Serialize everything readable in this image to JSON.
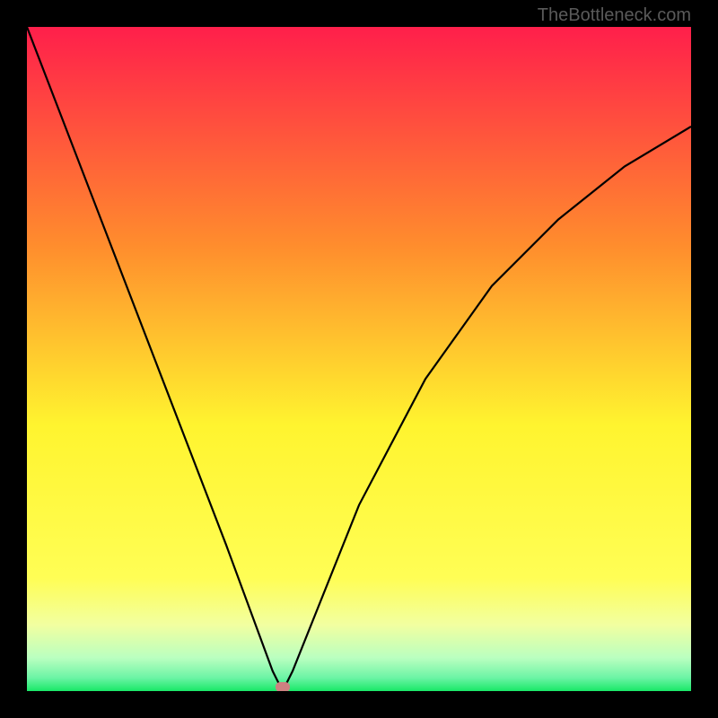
{
  "watermark": "TheBottleneck.com",
  "chart_data": {
    "type": "line",
    "title": "",
    "xlabel": "",
    "ylabel": "",
    "xlim": [
      0,
      100
    ],
    "ylim": [
      0,
      100
    ],
    "grid": false,
    "legend": false,
    "gradient_colors_top_to_bottom": [
      "#ff1f4b",
      "#ffb730",
      "#fffb33",
      "#efff9a",
      "#9bffc7",
      "#1cea6a"
    ],
    "series": [
      {
        "name": "bottleneck-curve",
        "x": [
          0,
          10,
          20,
          30,
          37,
          38.5,
          40,
          50,
          60,
          70,
          80,
          90,
          100
        ],
        "y": [
          100,
          74,
          48,
          22,
          3,
          0,
          3,
          28,
          47,
          61,
          71,
          79,
          85
        ]
      }
    ],
    "marker": {
      "x": 38.5,
      "y": 0.5,
      "color": "#ce8181"
    }
  }
}
